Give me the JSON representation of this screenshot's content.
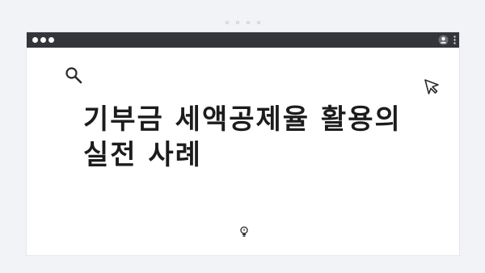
{
  "pager": {
    "dot_count": 4
  },
  "window": {
    "titlebar_color": "#34353a",
    "traffic_lights": [
      "dot",
      "dot",
      "dot"
    ],
    "icons": [
      "user-icon",
      "kebab-menu-icon"
    ]
  },
  "content": {
    "title": "기부금 세액공제율 활용의 실전 사례",
    "decorations": [
      "search-icon",
      "cursor-arrow-icon",
      "lightbulb-icon"
    ]
  },
  "colors": {
    "background": "#f2f3f7",
    "window": "#ffffff",
    "title_text": "#1c1c1c"
  }
}
